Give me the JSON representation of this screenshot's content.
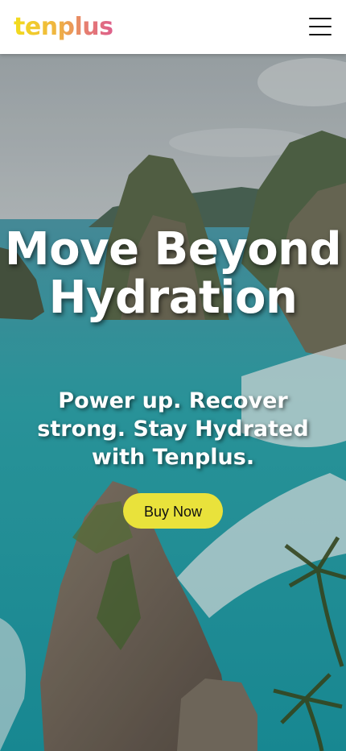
{
  "header": {
    "logo_text": "tenplus",
    "menu_icon": "hamburger-menu-icon"
  },
  "hero": {
    "title": "Move Beyond Hydration",
    "subtitle": "Power up. Recover strong. Stay Hydrated with Tenplus.",
    "cta_label": "Buy Now",
    "background": "coastal-cliffs-photo"
  },
  "colors": {
    "cta_background": "#e9e23b",
    "logo_gradient": [
      "#f2dd1c",
      "#efb243",
      "#e57a74",
      "#dd5f8c"
    ]
  }
}
